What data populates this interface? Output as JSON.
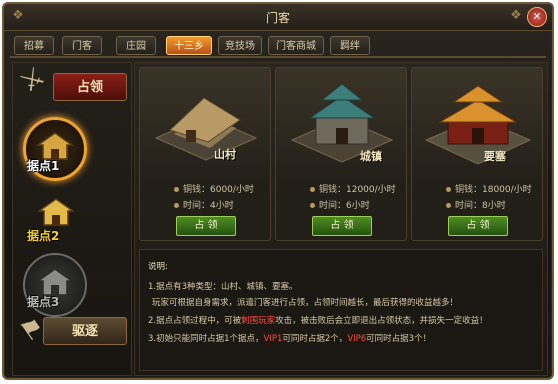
{
  "window": {
    "title": "门客",
    "close_label": "✕"
  },
  "tabs": [
    {
      "label": "招募"
    },
    {
      "label": "门客"
    },
    {
      "label": "庄园"
    },
    {
      "label": "十三乡"
    },
    {
      "label": "竞技场"
    },
    {
      "label": "门客商城"
    },
    {
      "label": "羁绊"
    }
  ],
  "active_tab": "十三乡",
  "sidebar": {
    "occupy_label": "占领",
    "expel_label": "驱逐",
    "points": [
      {
        "label": "据点1",
        "state": "active"
      },
      {
        "label": "据点2",
        "state": "available"
      },
      {
        "label": "据点3",
        "state": "locked"
      }
    ]
  },
  "buildings": [
    {
      "name": "山村",
      "income": "铜钱：6000/小时",
      "time": "时间：4小时",
      "button": "占 领"
    },
    {
      "name": "城镇",
      "income": "铜钱：12000/小时",
      "time": "时间：6小时",
      "button": "占 领"
    },
    {
      "name": "要塞",
      "income": "铜钱：18000/小时",
      "time": "时间：8小时",
      "button": "占 领"
    }
  ],
  "notes": {
    "heading": "说明:",
    "line1": "1.据点有3种类型：山村、城镇、要塞。",
    "line2": "玩家可根据自身需求，派遣门客进行占领，占领时间越长，最后获得的收益越多！",
    "line3_pre": "2.据点占领过程中，可被",
    "line3_red": "刺围玩家",
    "line3_post": "攻击，被击败后会立即退出占领状态，并损失一定收益！",
    "line4_pre": "3.初始只能同时占据1个据点，",
    "line4_red1": "VIP1",
    "line4_mid": "可同时占据2个，",
    "line4_red2": "VIP6",
    "line4_post": "可同时占据3个！"
  },
  "colors": {
    "active_tab": "#e07a22",
    "occupy_button": "#3f7a1c",
    "accent_red": "#ff4a3a",
    "gold_ring": "#f0a32f"
  }
}
